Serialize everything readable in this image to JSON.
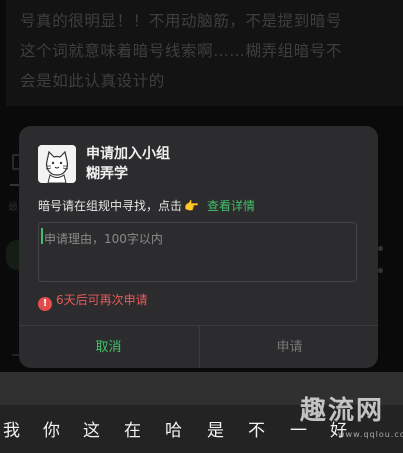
{
  "background": {
    "post_text_lines": [
      "号真的很明显！！不用动脑筋，不是提到暗号",
      "这个词就意味着暗号线索啊……糊弄组暗号不",
      "会是如此认真设计的"
    ],
    "section_label": "最"
  },
  "dialog": {
    "title": "申请加入小组",
    "group_name": "糊弄学",
    "avatar_icon": "cartoon-cat-avatar",
    "notice_text": "暗号请在组规中寻找，点击",
    "notice_pointer": "👉",
    "details_link": "查看详情",
    "reason_placeholder": "申请理由，100字以内",
    "reason_value": "",
    "warning_icon": "!",
    "warning_text": "6天后可再次申请",
    "cancel_label": "取消",
    "apply_label": "申请"
  },
  "keyboard": {
    "candidates": [
      "我",
      "你",
      "这",
      "在",
      "哈",
      "是",
      "不",
      "一",
      "好"
    ]
  },
  "watermark": {
    "text": "趣流网",
    "url": "www.qqlou.com"
  },
  "colors": {
    "accent_green": "#43c06a",
    "warning_red": "#e65a5a",
    "dialog_bg": "#2c2c2e"
  }
}
